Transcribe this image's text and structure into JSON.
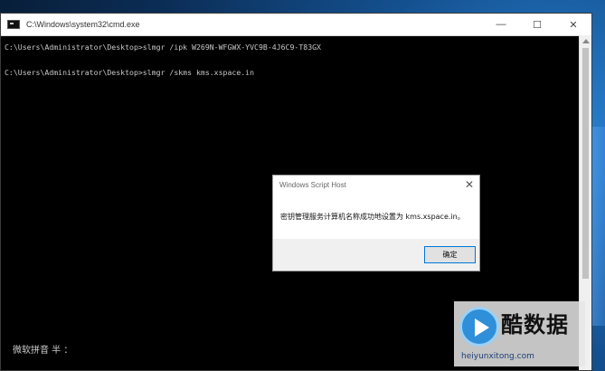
{
  "cmd": {
    "title": "C:\\Windows\\system32\\cmd.exe",
    "controls": {
      "minimize": "—",
      "maximize": "☐",
      "close": "✕"
    },
    "lines": [
      "C:\\Users\\Administrator\\Desktop>slmgr /ipk W269N-WFGWX-YVC9B-4J6C9-T83GX",
      "C:\\Users\\Administrator\\Desktop>slmgr /skms kms.xspace.in"
    ],
    "ime": "微软拼音 半 ："
  },
  "dialog": {
    "title": "Windows Script Host",
    "close": "✕",
    "message": "密钥管理服务计算机名称成功地设置为 kms.xspace.in。",
    "ok_label": "确定"
  },
  "watermark": {
    "brand": "酷数据",
    "site": "heiyunxitong.com"
  },
  "colors": {
    "accent": "#0078d7",
    "console_bg": "#000000",
    "console_text": "#c8c8c8"
  }
}
